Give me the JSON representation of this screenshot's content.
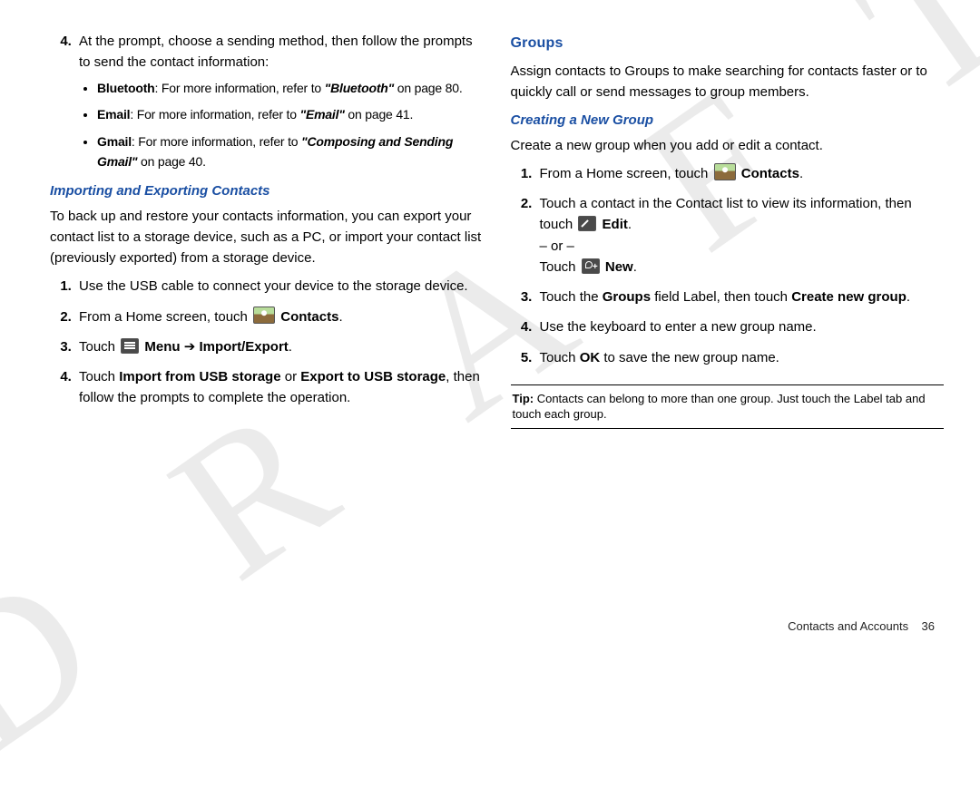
{
  "watermark": "D R A F T",
  "left": {
    "step4_lead": "At the prompt, choose a sending method, then follow the prompts to send the contact information:",
    "bullets": {
      "bt_label": "Bluetooth",
      "bt_text": ": For more information, refer to ",
      "bt_ref": "\"Bluetooth\"",
      "bt_tail": " on page 80.",
      "email_label": "Email",
      "email_text": ": For more information, refer to ",
      "email_ref": "\"Email\"",
      "email_tail": " on page 41.",
      "gmail_label": "Gmail",
      "gmail_text": ": For more information, refer to ",
      "gmail_ref": "\"Composing and Sending Gmail\"",
      "gmail_tail": " on page 40."
    },
    "importing_heading": "Importing and Exporting Contacts",
    "importing_intro": "To back up and restore your contacts information, you can export your contact list to a storage device, such as a PC, or import your contact list (previously exported) from a storage device.",
    "steps": {
      "s1": "Use the USB cable to connect your device to the storage device.",
      "s2_pre": "From a Home screen, touch ",
      "s2_post": "Contacts",
      "s2_tail": ".",
      "s3_pre": "Touch ",
      "s3_menu": "Menu",
      "s3_arrow": " ➔ ",
      "s3_action": "Import/Export",
      "s3_tail": ".",
      "s4_pre": "Touch ",
      "s4_a": "Import from USB storage",
      "s4_mid": " or ",
      "s4_b": "Export to USB storage",
      "s4_tail": ", then follow the prompts to complete the operation."
    }
  },
  "right": {
    "groups_heading": "Groups",
    "groups_intro": "Assign contacts to Groups to make searching for contacts faster or to quickly call or send messages to group members.",
    "creating_heading": "Creating a New Group",
    "creating_intro": "Create a new group when you add or edit a contact.",
    "steps": {
      "s1_pre": "From a Home screen, touch ",
      "s1_post": "Contacts",
      "s1_tail": ".",
      "s2_a": "Touch a contact in the Contact list to view its information, then touch ",
      "s2_edit": "Edit",
      "s2_tail1": ".",
      "s2_or": "– or –",
      "s2_touch": "Touch ",
      "s2_new": "New",
      "s2_tail2": ".",
      "s3_pre": "Touch the ",
      "s3_groups": "Groups",
      "s3_mid": " field Label, then touch ",
      "s3_create": "Create new group",
      "s3_tail": ".",
      "s4": "Use the keyboard to enter a new group name.",
      "s5_pre": "Touch ",
      "s5_ok": "OK",
      "s5_tail": " to save the new group name."
    },
    "tip_label": "Tip:",
    "tip_text": " Contacts can belong to more than one group. Just touch the Label tab and touch each group."
  },
  "footer": {
    "section": "Contacts and Accounts",
    "page": "36"
  }
}
